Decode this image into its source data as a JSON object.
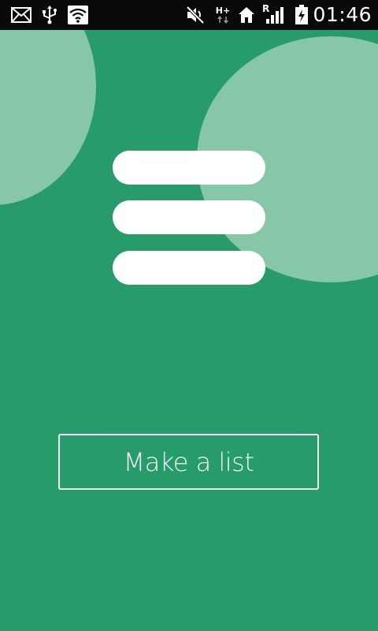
{
  "status_bar": {
    "time": "01:46",
    "network_label": "H+",
    "roaming_label": "R",
    "icons": [
      "email-icon",
      "usb-icon",
      "wifi-icon",
      "mute-icon",
      "hplus-data-icon",
      "home-icon",
      "signal-roaming-icon",
      "battery-charging-icon"
    ]
  },
  "colors": {
    "status_bar_bg": "#0a0a0a",
    "app_bg": "#279b69",
    "bubble": "#85c7a6",
    "foreground": "#ffffff"
  },
  "logo": {
    "icon": "list-lines-icon"
  },
  "main": {
    "primary_button_label": "Make a list"
  }
}
